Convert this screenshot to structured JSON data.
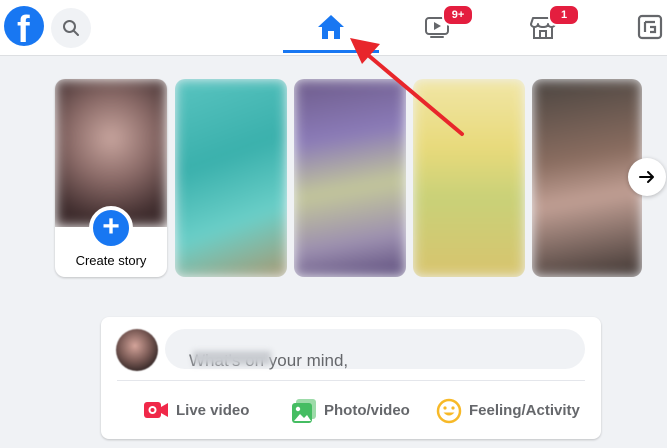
{
  "header": {
    "logo_letter": "f",
    "tabs": [
      {
        "id": "home",
        "active": true
      },
      {
        "id": "watch",
        "badge": "9+"
      },
      {
        "id": "marketplace",
        "badge": "1"
      },
      {
        "id": "groups"
      }
    ]
  },
  "stories": {
    "create_label": "Create story",
    "plus_symbol": "+"
  },
  "composer": {
    "placeholder": "What's on your mind,",
    "actions": [
      {
        "label": "Live video",
        "icon": "live-video-icon",
        "color": "#f02849"
      },
      {
        "label": "Photo/video",
        "icon": "photo-video-icon",
        "color": "#45bd62"
      },
      {
        "label": "Feeling/Activity",
        "icon": "feeling-icon",
        "color": "#f7b928"
      }
    ]
  },
  "colors": {
    "brand": "#1877f2",
    "badge": "#e41e3f",
    "annotation_arrow": "#e8262b"
  }
}
